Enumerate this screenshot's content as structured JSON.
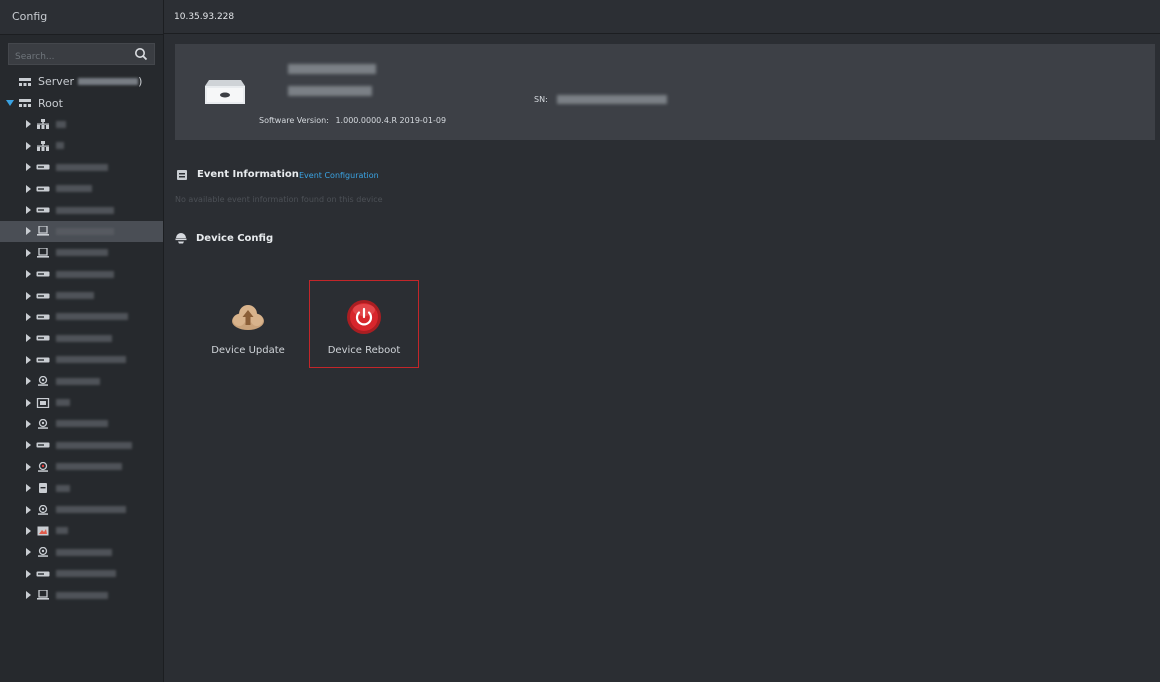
{
  "sidebar": {
    "title": "Config",
    "search_placeholder": "Search...",
    "server_label": "Server",
    "server_suffix": ")",
    "root_label": "Root",
    "tree_items": [
      {
        "icon": "org-icon",
        "w": 10
      },
      {
        "icon": "org-icon",
        "w": 8
      },
      {
        "icon": "nvr-icon",
        "w": 52
      },
      {
        "icon": "nvr-icon",
        "w": 36
      },
      {
        "icon": "nvr-icon",
        "w": 58
      },
      {
        "icon": "access-icon",
        "w": 58,
        "selected": true
      },
      {
        "icon": "access-icon",
        "w": 52
      },
      {
        "icon": "nvr-icon",
        "w": 58
      },
      {
        "icon": "nvr-icon",
        "w": 38
      },
      {
        "icon": "nvr-icon",
        "w": 72
      },
      {
        "icon": "nvr-icon",
        "w": 56
      },
      {
        "icon": "nvr-icon",
        "w": 70
      },
      {
        "icon": "camera-icon",
        "w": 44
      },
      {
        "icon": "screen-icon",
        "w": 14
      },
      {
        "icon": "camera-icon",
        "w": 52
      },
      {
        "icon": "nvr-icon",
        "w": 76
      },
      {
        "icon": "camera-alert-icon",
        "w": 66
      },
      {
        "icon": "box-icon",
        "w": 14
      },
      {
        "icon": "camera-icon",
        "w": 70
      },
      {
        "icon": "picture-icon",
        "w": 12
      },
      {
        "icon": "camera-icon",
        "w": 56
      },
      {
        "icon": "nvr-icon",
        "w": 60
      },
      {
        "icon": "access-icon",
        "w": 52
      }
    ]
  },
  "topbar": {
    "ip": "10.35.93.228"
  },
  "device": {
    "software_version_label": "Software Version:",
    "software_version_value": "1.000.0000.4.R 2019-01-09",
    "sn_label": "SN:"
  },
  "event": {
    "title": "Event Information",
    "config_link": "Event Configuration",
    "empty_text": "No available event information found on this device"
  },
  "device_config": {
    "title": "Device Config",
    "update_label": "Device Update",
    "reboot_label": "Device Reboot"
  },
  "colors": {
    "accent_link": "#3aa3e3",
    "selected_border": "#c3262a",
    "reboot_red": "#d8262c"
  }
}
